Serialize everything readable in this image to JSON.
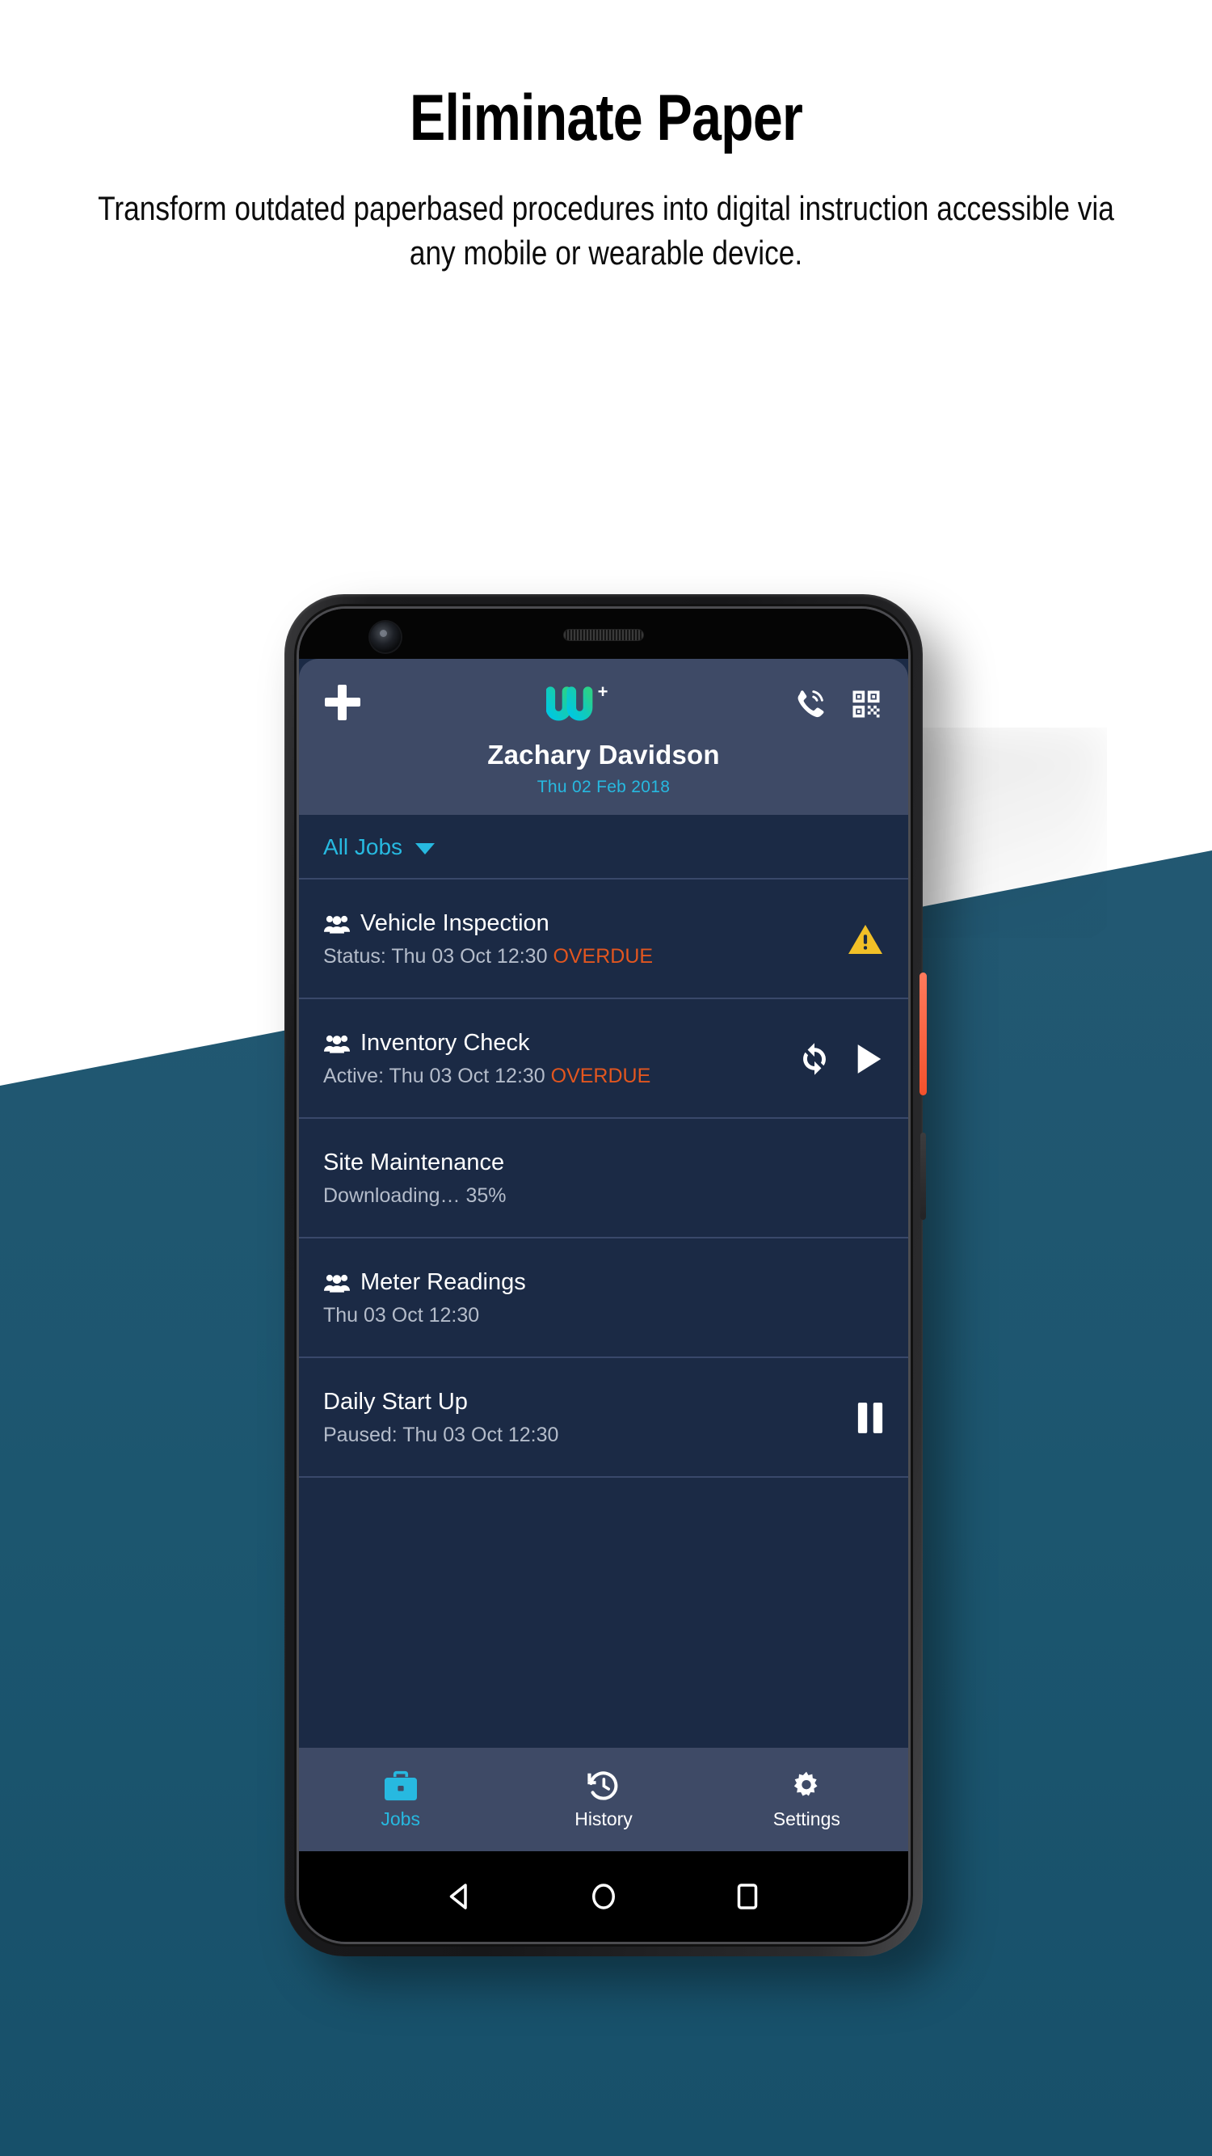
{
  "hero": {
    "title": "Eliminate Paper",
    "subtitle": "Transform outdated paperbased procedures into digital instruction accessible via any mobile or wearable device."
  },
  "colors": {
    "accent_cyan": "#27b9e0",
    "logo_gradient_from": "#00c8e0",
    "logo_gradient_to": "#28cf8d",
    "header_bg": "#3e4a66",
    "list_bg": "#1b2a45",
    "divider": "#39486a",
    "overdue": "#e2561f",
    "warning_yellow": "#f2c027",
    "background_band": "#235872",
    "power_button": "#f2512c"
  },
  "app": {
    "header": {
      "add_icon": "plus-icon",
      "logo_letter": "W",
      "logo_superscript": "+",
      "call_icon": "phone-call-icon",
      "qr_icon": "qr-code-icon",
      "user_name": "Zachary Davidson",
      "date": "Thu 02 Feb 2018"
    },
    "filter": {
      "label": "All Jobs",
      "caret_icon": "chevron-down-icon"
    },
    "jobs": [
      {
        "title": "Vehicle Inspection",
        "status_prefix": "Status: Thu 03 Oct 12:30 ",
        "status_flag": "OVERDUE",
        "has_group_icon": true,
        "actions": [
          "warning-icon"
        ]
      },
      {
        "title": "Inventory Check",
        "status_prefix": "Active: Thu 03 Oct 12:30 ",
        "status_flag": "OVERDUE",
        "has_group_icon": true,
        "actions": [
          "sync-icon",
          "play-icon"
        ]
      },
      {
        "title": "Site Maintenance",
        "status_prefix": "Downloading… 35%",
        "status_flag": "",
        "has_group_icon": false,
        "actions": []
      },
      {
        "title": "Meter Readings",
        "status_prefix": "Thu 03 Oct 12:30",
        "status_flag": "",
        "has_group_icon": true,
        "actions": []
      },
      {
        "title": "Daily Start Up",
        "status_prefix": "Paused: Thu 03 Oct 12:30",
        "status_flag": "",
        "has_group_icon": false,
        "actions": [
          "pause-icon"
        ]
      }
    ],
    "bottom_nav": [
      {
        "label": "Jobs",
        "icon": "briefcase-icon",
        "active": true
      },
      {
        "label": "History",
        "icon": "history-clock-icon",
        "active": false
      },
      {
        "label": "Settings",
        "icon": "gear-icon",
        "active": false
      }
    ],
    "android_nav": [
      {
        "icon": "back-triangle-icon"
      },
      {
        "icon": "home-circle-icon"
      },
      {
        "icon": "recents-square-icon"
      }
    ]
  }
}
